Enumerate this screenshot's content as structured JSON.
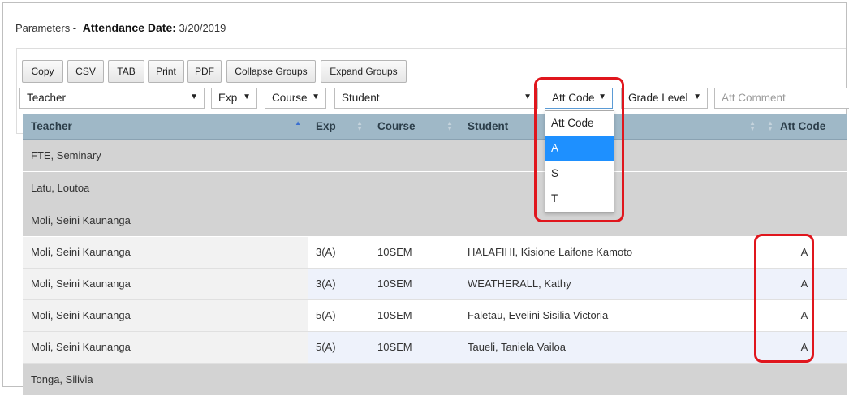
{
  "params": {
    "prefix": "Parameters -",
    "label": "Attendance Date:",
    "value": "3/20/2019"
  },
  "toolbar": {
    "copy": "Copy",
    "csv": "CSV",
    "tab": "TAB",
    "print": "Print",
    "pdf": "PDF",
    "collapse": "Collapse Groups",
    "expand": "Expand Groups"
  },
  "filters": {
    "teacher": "Teacher",
    "exp": "Exp",
    "course": "Course",
    "student": "Student",
    "att_code": "Att Code",
    "grade_level": "Grade Level",
    "att_comment_placeholder": "Att Comment"
  },
  "columns": {
    "teacher": "Teacher",
    "exp": "Exp",
    "course": "Course",
    "student": "Student",
    "att_code": "Att Code"
  },
  "groups": [
    "FTE, Seminary",
    "Latu, Loutoa",
    "Moli, Seini Kaunanga",
    "Tonga, Silivia"
  ],
  "rows": [
    {
      "teacher": "Moli, Seini Kaunanga",
      "exp": "3(A)",
      "course": "10SEM",
      "student": "HALAFIHI, Kisione Laifone Kamoto",
      "att": "A"
    },
    {
      "teacher": "Moli, Seini Kaunanga",
      "exp": "3(A)",
      "course": "10SEM",
      "student": "WEATHERALL, Kathy",
      "att": "A"
    },
    {
      "teacher": "Moli, Seini Kaunanga",
      "exp": "5(A)",
      "course": "10SEM",
      "student": "Faletau, Evelini Sisilia Victoria",
      "att": "A"
    },
    {
      "teacher": "Moli, Seini Kaunanga",
      "exp": "5(A)",
      "course": "10SEM",
      "student": "Taueli, Taniela Vailoa",
      "att": "A"
    }
  ],
  "dropdown": {
    "options": [
      "Att Code",
      "A",
      "S",
      "T"
    ],
    "selected": "A"
  },
  "icons": {
    "dropdown_arrow": "caret-down-icon",
    "sort": "sort-arrows-icon"
  },
  "colors": {
    "header_bg": "#9fb8c7",
    "group_bg": "#d3d3d3",
    "highlight": "#e0161d",
    "option_active": "#1e90ff"
  }
}
